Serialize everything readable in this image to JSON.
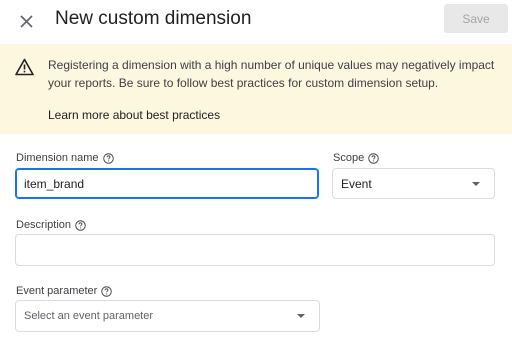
{
  "header": {
    "title": "New custom dimension",
    "save_label": "Save"
  },
  "banner": {
    "message": "Registering a dimension with a high number of unique values may negatively impact your reports. Be sure to follow best practices for custom dimension setup.",
    "link_text": "Learn more about best practices",
    "background_color": "#fef7e0"
  },
  "form": {
    "dimension_name": {
      "label": "Dimension name",
      "value": "item_brand"
    },
    "scope": {
      "label": "Scope",
      "selected": "Event"
    },
    "description": {
      "label": "Description",
      "value": ""
    },
    "event_parameter": {
      "label": "Event parameter",
      "placeholder": "Select an event parameter"
    }
  },
  "colors": {
    "focus_border": "#1a73e8",
    "save_disabled_bg": "#e8e8e8"
  }
}
